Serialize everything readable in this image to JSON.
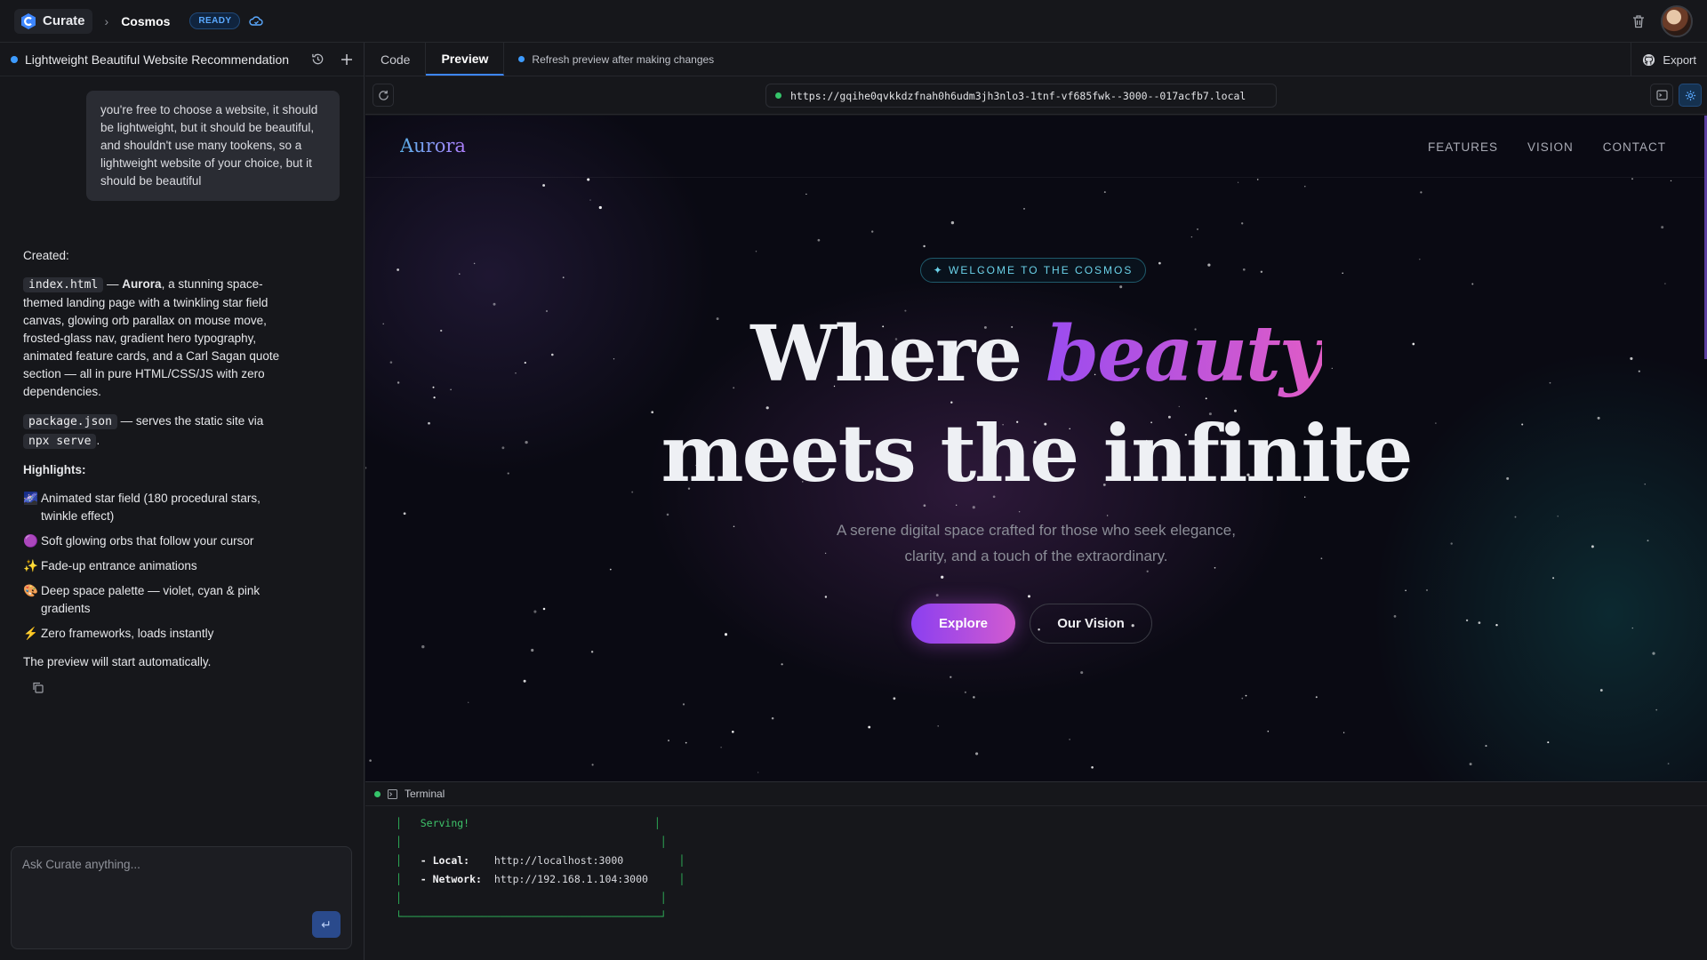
{
  "topbar": {
    "brand": "Curate",
    "project": "Cosmos",
    "status": "READY"
  },
  "chat": {
    "title": "Lightweight Beautiful Website Recommendation",
    "user_message": "you're free to choose a website, it should be lightweight, but it should be beautiful, and shouldn't use many tookens, so a lightweight website of your choice, but it should be beautiful",
    "created_label": "Created:",
    "file1_name": "index.html",
    "file1_dash": " — ",
    "file1_bold": "Aurora",
    "file1_desc": ", a stunning space-themed landing page with a twinkling star field canvas, glowing orb parallax on mouse move, frosted-glass nav, gradient hero typography, animated feature cards, and a Carl Sagan quote section — all in pure HTML/CSS/JS with zero dependencies.",
    "file2_name": "package.json",
    "file2_desc": " — serves the static site via ",
    "file2_cmd": "npx serve",
    "file2_end": ".",
    "highlights_label": "Highlights:",
    "highlights": [
      {
        "icon": "🌌",
        "text": "Animated star field (180 procedural stars, twinkle effect)"
      },
      {
        "icon": "🟣",
        "text": "Soft glowing orbs that follow your cursor"
      },
      {
        "icon": "✨",
        "text": "Fade-up entrance animations"
      },
      {
        "icon": "🎨",
        "text": "Deep space palette — violet, cyan & pink gradients"
      },
      {
        "icon": "⚡",
        "text": "Zero frameworks, loads instantly"
      }
    ],
    "closing": "The preview will start automatically.",
    "input_placeholder": "Ask Curate anything..."
  },
  "editor": {
    "tab_code": "Code",
    "tab_preview": "Preview",
    "refresh_note": "Refresh preview after making changes",
    "export_label": "Export",
    "url": "https://gqihe0qvkkdzfnah0h6udm3jh3nlo3-1tnf-vf685fwk--3000--017acfb7.local"
  },
  "site": {
    "logo": "Aurora",
    "nav": [
      "FEATURES",
      "VISION",
      "CONTACT"
    ],
    "badge": "✦ WELCOME TO THE COSMOS",
    "headline_1a": "Where ",
    "headline_1b": "beauty",
    "headline_2": "meets the infinite",
    "sub_1": "A serene digital space crafted for those who seek elegance,",
    "sub_2": "clarity, and a touch of the extraordinary.",
    "btn_primary": "Explore",
    "btn_secondary": "Our Vision"
  },
  "terminal": {
    "title": "Terminal",
    "serving": "Serving!",
    "local_label": "- Local:",
    "local_url": "http://localhost:3000",
    "network_label": "- Network:",
    "network_url": "http://192.168.1.104:3000"
  },
  "colors": {
    "accent": "#3d86ff",
    "ready": "#5aa9ff",
    "primary_btn_start": "#8b3ff0",
    "primary_btn_end": "#d25bd0",
    "terminal_green": "#2eb35a"
  }
}
